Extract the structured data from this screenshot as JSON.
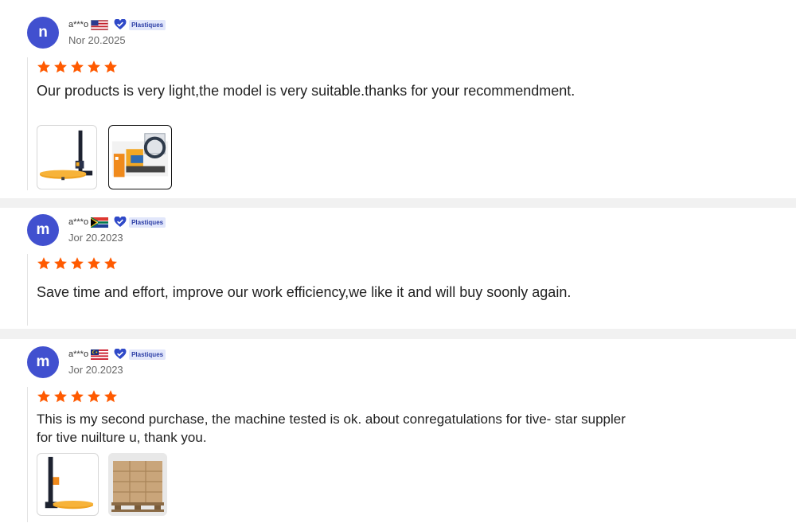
{
  "reviews": [
    {
      "avatar_letter": "n",
      "username": "a***o",
      "flag_icon": "us-flag-icon",
      "badge_text": "Plastiques",
      "date": "Nor 20.2025",
      "rating": 5,
      "text": "Our products is very light,the model is very suitable.thanks for your recommendment.",
      "images": [
        "stretch-wrapper-machine-image",
        "orbital-wrapping-machine-image"
      ]
    },
    {
      "avatar_letter": "m",
      "username": "a***o",
      "flag_icon": "south-africa-flag-icon",
      "badge_text": "Plastiques",
      "date": "Jor 20.2023",
      "rating": 5,
      "text": "Save time and effort, improve our work efficiency,we like it and will buy soonly again.",
      "images": []
    },
    {
      "avatar_letter": "m",
      "username": "a***o",
      "flag_icon": "malaysia-flag-icon",
      "badge_text": "Plastiques",
      "date": "Jor 20.2023",
      "rating": 5,
      "text_line1": "This is my second purchase, the machine tested is ok. about conregatulations for tive- star suppler",
      "text_line2": "for tive nuilture u, thank you.",
      "images": [
        "stretch-wrapper-machine-image",
        "wrapped-pallet-image"
      ]
    }
  ],
  "colors": {
    "avatar": "#4150cf",
    "star": "#ff5a00",
    "badge_text": "#2c3ea6",
    "badge_bg": "#e2e7fb"
  }
}
